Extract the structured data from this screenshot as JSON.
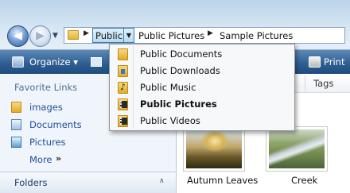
{
  "address_bar": {
    "breadcrumbs": [
      "Public",
      "Public Pictures",
      "Sample Pictures"
    ],
    "back_glyph": "◀",
    "forward_glyph": "▶",
    "separator_glyph": "▶",
    "dropdown_glyph": "▼"
  },
  "toolbar": {
    "organize_label": "Organize",
    "organize_arrow": "▾",
    "print_label": "Print"
  },
  "nav_pane": {
    "favorites_title": "Favorite Links",
    "favorites": [
      {
        "label": "images",
        "icon": "folder-icon"
      },
      {
        "label": "Documents",
        "icon": "documents-icon"
      },
      {
        "label": "Pictures",
        "icon": "pictures-icon"
      }
    ],
    "more_label": "More",
    "more_arrows": "»",
    "folders_label": "Folders",
    "folders_chevron": "∧"
  },
  "content": {
    "column_tags": "Tags",
    "thumbnails": [
      {
        "label": "Autumn Leaves"
      },
      {
        "label": "Creek"
      }
    ]
  },
  "dropdown_menu": {
    "items": [
      {
        "label": "Public Documents",
        "icon": "folder-icon",
        "selected": false
      },
      {
        "label": "Public Downloads",
        "icon": "downloads-folder-icon",
        "selected": false
      },
      {
        "label": "Public Music",
        "icon": "music-folder-icon",
        "selected": false
      },
      {
        "label": "Public Pictures",
        "icon": "pictures-folder-icon",
        "selected": true
      },
      {
        "label": "Public Videos",
        "icon": "videos-folder-icon",
        "selected": false
      }
    ]
  }
}
